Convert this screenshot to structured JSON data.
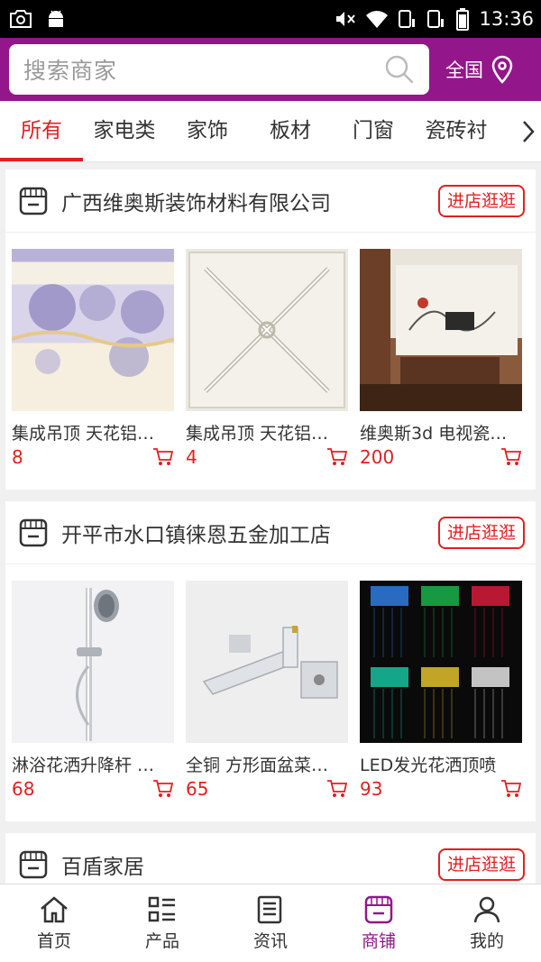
{
  "status_bar": {
    "time": "13:36"
  },
  "search": {
    "placeholder": "搜索商家",
    "region": "全国"
  },
  "tabs": [
    {
      "label": "所有",
      "active": true
    },
    {
      "label": "家电类"
    },
    {
      "label": "家饰"
    },
    {
      "label": "板材"
    },
    {
      "label": "门窗"
    },
    {
      "label": "瓷砖衬"
    }
  ],
  "shops": [
    {
      "name": "广西维奥斯装饰材料有限公司",
      "button": "进店逛逛",
      "products": [
        {
          "name": "集成吊顶 天花铝…",
          "price": "8"
        },
        {
          "name": "集成吊顶 天花铝…",
          "price": "4"
        },
        {
          "name": "维奥斯3d 电视瓷…",
          "price": "200"
        }
      ]
    },
    {
      "name": "开平市水口镇徕恩五金加工店",
      "button": "进店逛逛",
      "products": [
        {
          "name": "淋浴花洒升降杆 …",
          "price": "68"
        },
        {
          "name": "全铜 方形面盆菜…",
          "price": "65"
        },
        {
          "name": "LED发光花洒顶喷",
          "price": "93"
        }
      ]
    },
    {
      "name": "百盾家居",
      "button": "进店逛逛",
      "products": []
    }
  ],
  "bottom_nav": [
    {
      "label": "首页",
      "icon": "home-icon"
    },
    {
      "label": "产品",
      "icon": "list-icon"
    },
    {
      "label": "资讯",
      "icon": "news-icon"
    },
    {
      "label": "商铺",
      "icon": "store-icon",
      "active": true
    },
    {
      "label": "我的",
      "icon": "user-icon"
    }
  ],
  "colors": {
    "brand": "#93168a",
    "accent": "#e0201f"
  }
}
